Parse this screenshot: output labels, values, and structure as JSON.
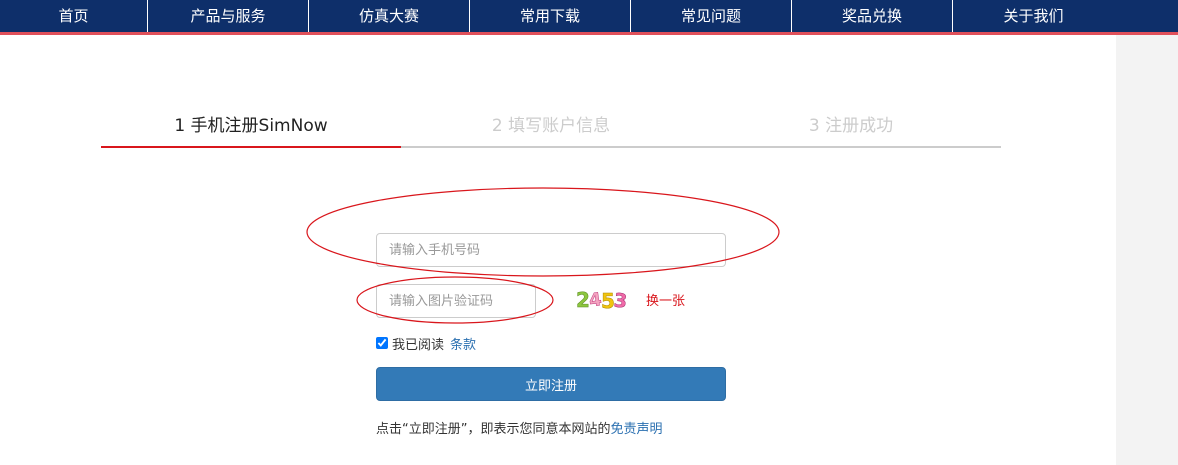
{
  "nav": {
    "items": [
      {
        "label": "首页"
      },
      {
        "label": "产品与服务"
      },
      {
        "label": "仿真大赛"
      },
      {
        "label": "常用下载"
      },
      {
        "label": "常见问题"
      },
      {
        "label": "奖品兑换"
      },
      {
        "label": "关于我们"
      }
    ],
    "bg_color": "#0e2f6a",
    "accent_color": "#e0505a"
  },
  "steps": [
    {
      "label": "1 手机注册SimNow",
      "active": true
    },
    {
      "label": "2 填写账户信息",
      "active": false
    },
    {
      "label": "3 注册成功",
      "active": false
    }
  ],
  "form": {
    "phone_placeholder": "请输入手机号码",
    "phone_value": "",
    "captcha_placeholder": "请输入图片验证码",
    "captcha_value": "",
    "captcha_image_text": "2453",
    "refresh_label": "换一张",
    "agree_checked": true,
    "agree_label": "我已阅读",
    "terms_label": "条款",
    "register_label": "立即注册",
    "disclaimer_text": "点击“立即注册”，即表示您同意本网站的",
    "disclaimer_link": "免责声明"
  },
  "colors": {
    "step_active_border": "#d9161c",
    "button_bg": "#337ab7",
    "annotation_color": "#d9161c",
    "link_color": "#2a6fb0"
  }
}
